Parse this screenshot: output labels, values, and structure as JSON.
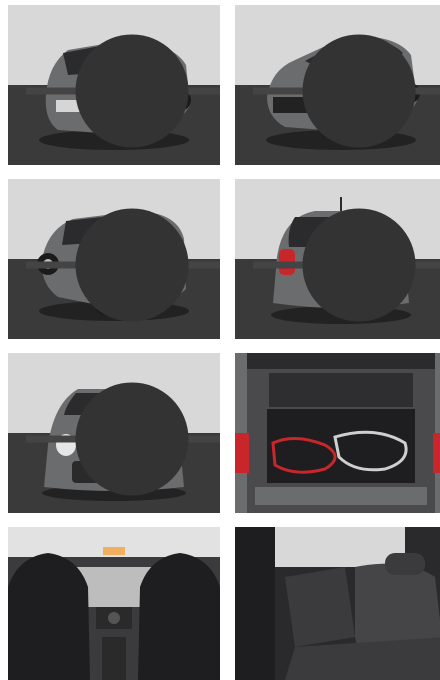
{
  "gallery": {
    "photos": [
      {
        "view": "rear-three-quarter-left",
        "kind": "exterior"
      },
      {
        "view": "front-three-quarter-right",
        "kind": "exterior"
      },
      {
        "view": "rear-three-quarter-left-low",
        "kind": "exterior"
      },
      {
        "view": "rear",
        "kind": "exterior"
      },
      {
        "view": "front",
        "kind": "exterior"
      },
      {
        "view": "trunk-open",
        "kind": "interior"
      },
      {
        "view": "dashboard-from-rear",
        "kind": "interior"
      },
      {
        "view": "rear-seats",
        "kind": "interior"
      }
    ],
    "colors": {
      "wall": "#d6d6d6",
      "floor": "#3a3a3a",
      "car_body": "#6b6c6e",
      "car_roof": "#2b2b2d",
      "tail_light": "#c8262a",
      "interior_dark": "#1e1e20",
      "interior_mid": "#3b3b3e"
    }
  }
}
